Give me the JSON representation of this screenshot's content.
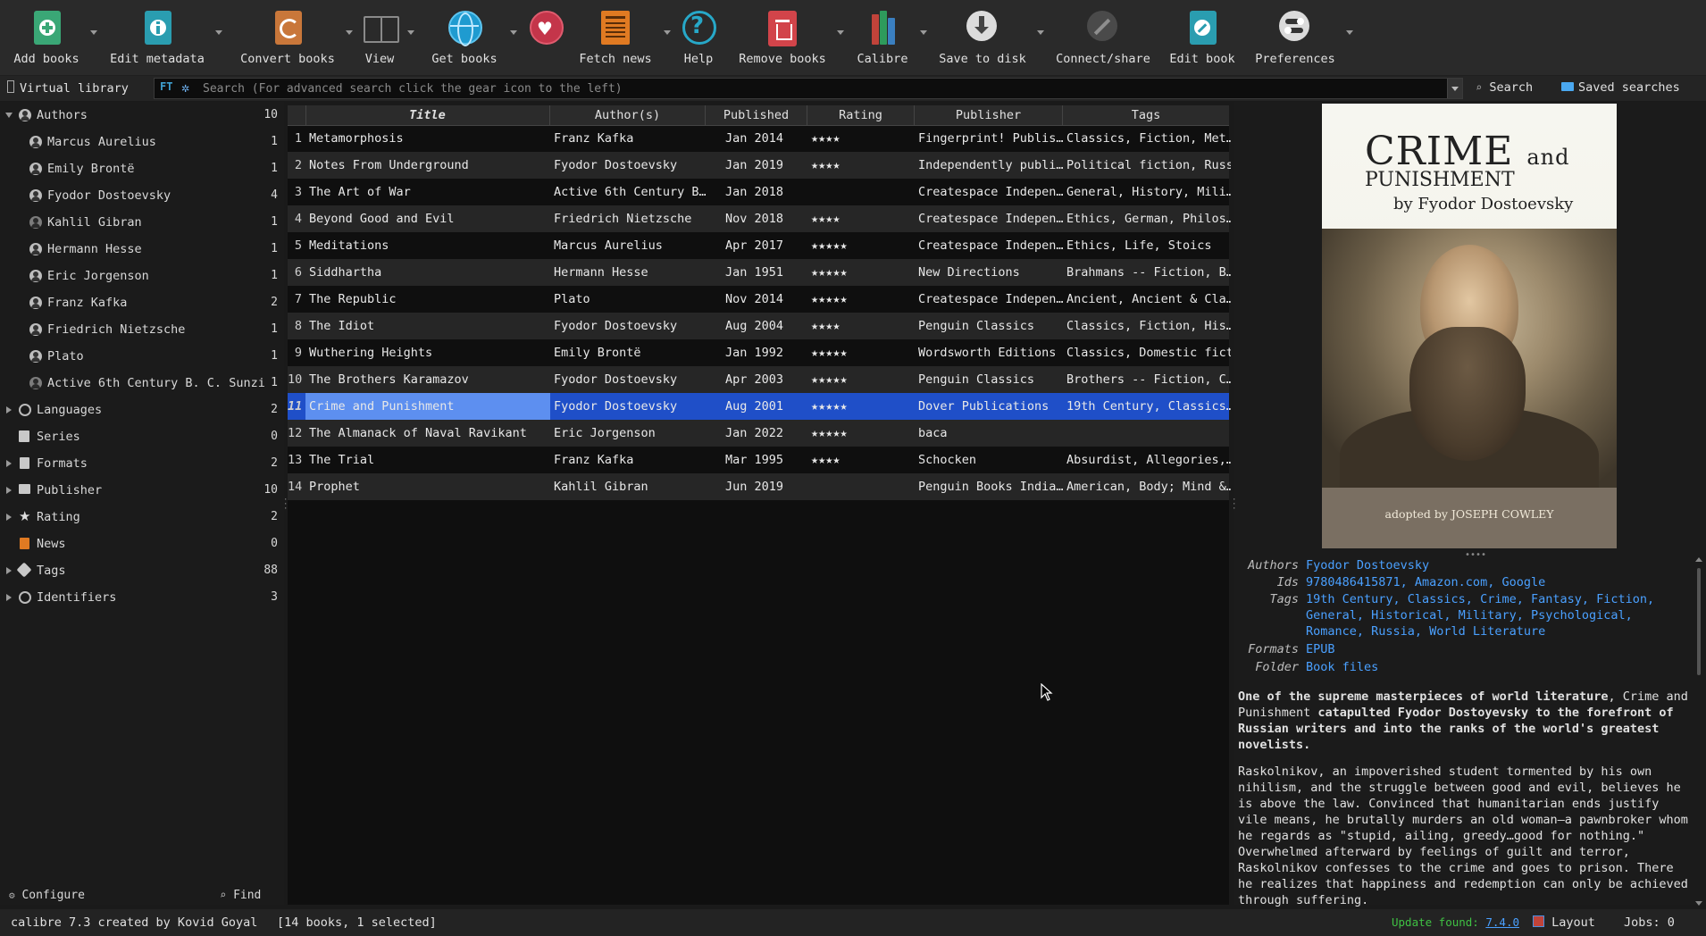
{
  "toolbar": {
    "add_books": "Add books",
    "edit_metadata": "Edit metadata",
    "convert_books": "Convert books",
    "view": "View",
    "get_books": "Get books",
    "fetch_news": "Fetch news",
    "help": "Help",
    "remove_books": "Remove books",
    "calibre": "Calibre",
    "save_to_disk": "Save to disk",
    "connect_share": "Connect/share",
    "edit_book": "Edit book",
    "preferences": "Preferences"
  },
  "searchbar": {
    "virtual_library": "Virtual library",
    "ft_label": "FT",
    "placeholder": "Search (For advanced search click the gear icon to the left)",
    "search_label": "Search",
    "saved_searches_label": "Saved searches"
  },
  "tag_browser": {
    "authors": {
      "label": "Authors",
      "count": "10"
    },
    "author_items": [
      {
        "name": "Marcus Aurelius",
        "count": "1"
      },
      {
        "name": "Emily Brontë",
        "count": "1"
      },
      {
        "name": "Fyodor Dostoevsky",
        "count": "4"
      },
      {
        "name": "Kahlil Gibran",
        "count": "1"
      },
      {
        "name": "Hermann Hesse",
        "count": "1"
      },
      {
        "name": "Eric Jorgenson",
        "count": "1"
      },
      {
        "name": "Franz Kafka",
        "count": "2"
      },
      {
        "name": "Friedrich Nietzsche",
        "count": "1"
      },
      {
        "name": "Plato",
        "count": "1"
      },
      {
        "name": "Active 6th Century B. C. Sunzi",
        "count": "1"
      }
    ],
    "categories": [
      {
        "name": "Languages",
        "count": "2"
      },
      {
        "name": "Series",
        "count": "0"
      },
      {
        "name": "Formats",
        "count": "2"
      },
      {
        "name": "Publisher",
        "count": "10"
      },
      {
        "name": "Rating",
        "count": "2"
      },
      {
        "name": "News",
        "count": "0"
      },
      {
        "name": "Tags",
        "count": "88"
      },
      {
        "name": "Identifiers",
        "count": "3"
      }
    ],
    "configure": "Configure",
    "find": "Find"
  },
  "table": {
    "columns": [
      "Title",
      "Author(s)",
      "Published",
      "Rating",
      "Publisher",
      "Tags"
    ],
    "rows": [
      {
        "num": "1",
        "title": "Metamorphosis",
        "author": "Franz Kafka",
        "published": "Jan 2014",
        "rating": "★★★★",
        "publisher": "Fingerprint! Publis…",
        "tags": "Classics, Fiction, Met…"
      },
      {
        "num": "2",
        "title": "Notes From Underground",
        "author": "Fyodor Dostoevsky",
        "published": "Jan 2019",
        "rating": "★★★★",
        "publisher": "Independently publi…",
        "tags": "Political fiction, Russ…"
      },
      {
        "num": "3",
        "title": "The Art of War",
        "author": "Active 6th Century B…",
        "published": "Jan 2018",
        "rating": "",
        "publisher": "Createspace Indepen…",
        "tags": "General, History, Mili…"
      },
      {
        "num": "4",
        "title": "Beyond Good and Evil",
        "author": "Friedrich Nietzsche",
        "published": "Nov 2018",
        "rating": "★★★★",
        "publisher": "Createspace Indepen…",
        "tags": "Ethics, German, Philos…"
      },
      {
        "num": "5",
        "title": "Meditations",
        "author": "Marcus Aurelius",
        "published": "Apr 2017",
        "rating": "★★★★★",
        "publisher": "Createspace Indepen…",
        "tags": "Ethics, Life, Stoics"
      },
      {
        "num": "6",
        "title": "Siddhartha",
        "author": "Hermann Hesse",
        "published": "Jan 1951",
        "rating": "★★★★★",
        "publisher": "New Directions",
        "tags": "Brahmans -- Fiction, B…"
      },
      {
        "num": "7",
        "title": "The Republic",
        "author": "Plato",
        "published": "Nov 2014",
        "rating": "★★★★★",
        "publisher": "Createspace Indepen…",
        "tags": "Ancient, Ancient & Cla…"
      },
      {
        "num": "8",
        "title": "The Idiot",
        "author": "Fyodor Dostoevsky",
        "published": "Aug 2004",
        "rating": "★★★★",
        "publisher": "Penguin Classics",
        "tags": "Classics, Fiction, His…"
      },
      {
        "num": "9",
        "title": "Wuthering Heights",
        "author": "Emily Brontë",
        "published": "Jan 1992",
        "rating": "★★★★★",
        "publisher": "Wordsworth Editions",
        "tags": "Classics, Domestic fict…"
      },
      {
        "num": "10",
        "title": "The Brothers Karamazov",
        "author": "Fyodor Dostoevsky",
        "published": "Apr 2003",
        "rating": "★★★★★",
        "publisher": "Penguin Classics",
        "tags": "Brothers -- Fiction, C…"
      },
      {
        "num": "11",
        "title": "Crime and Punishment",
        "author": "Fyodor Dostoevsky",
        "published": "Aug 2001",
        "rating": "★★★★★",
        "publisher": "Dover Publications",
        "tags": "19th Century, Classics…"
      },
      {
        "num": "12",
        "title": "The Almanack of Naval Ravikant",
        "author": "Eric Jorgenson",
        "published": "Jan 2022",
        "rating": "★★★★★",
        "publisher": "baca",
        "tags": ""
      },
      {
        "num": "13",
        "title": "The Trial",
        "author": "Franz Kafka",
        "published": "Mar 1995",
        "rating": "★★★★",
        "publisher": "Schocken",
        "tags": "Absurdist, Allegories,…"
      },
      {
        "num": "14",
        "title": "Prophet",
        "author": "Kahlil Gibran",
        "published": "Jun 2019",
        "rating": "",
        "publisher": "Penguin Books India…",
        "tags": "American, Body; Mind &…"
      }
    ]
  },
  "details": {
    "cover": {
      "title_line1": "CRIME",
      "title_and": "and",
      "title_line2": "PUNISHMENT",
      "byline": "by Fyodor Dostoevsky",
      "adapted": "adopted by JOSEPH COWLEY"
    },
    "authors_key": "Authors",
    "authors_val": "Fyodor Dostoevsky",
    "ids_key": "Ids",
    "ids_val": "9780486415871, Amazon.com, Google",
    "tags_key": "Tags",
    "tags_line1": "19th Century, Classics, Crime, Fantasy, Fiction,",
    "tags_line2": "General, Historical, Military, Psychological,",
    "tags_line3": "Romance, Russia, World Literature",
    "formats_key": "Formats",
    "formats_val": "EPUB",
    "folder_key": "Folder",
    "folder_val": "Book files",
    "desc_bold1": "One of the supreme masterpieces of world literature",
    "desc_plain1": ", Crime and Punishment ",
    "desc_bold2": "catapulted Fyodor Dostoyevsky to the forefront of Russian writers and into the ranks of the world's greatest novelists.",
    "desc_p2": "Raskolnikov, an impoverished student tormented by his own nihilism, and the struggle between good and evil, believes he is above the law. Convinced that humanitarian ends justify vile means, he brutally murders an old woman—a pawnbroker whom he regards as \"stupid, ailing, greedy…good for nothing.\" Overwhelmed afterward by feelings of guilt and terror, Raskolnikov confesses to the crime and goes to prison. There he realizes that happiness and redemption can only be achieved through suffering."
  },
  "status": {
    "created_by": "calibre 7.3 created by Kovid Goyal",
    "books_info": "[14 books, 1 selected]",
    "update_label": "Update found:",
    "update_version": "7.4.0",
    "layout": "Layout",
    "jobs": "Jobs: 0"
  },
  "colors": {
    "accent": "#1f4fc8",
    "link": "#4aa0ff",
    "update_green": "#3fc043"
  }
}
